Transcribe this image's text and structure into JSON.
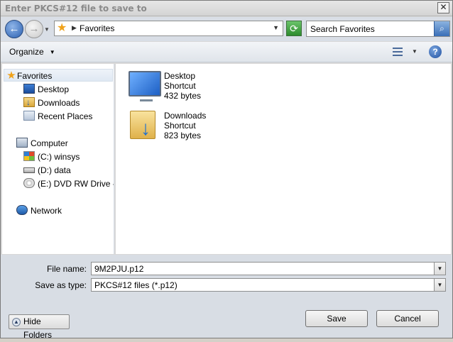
{
  "window": {
    "title": "Enter PKCS#12 file to save to",
    "close_glyph": "✕"
  },
  "nav": {
    "back_glyph": "←",
    "forward_glyph": "→",
    "address_location": "Favorites",
    "search_placeholder": "Search Favorites"
  },
  "toolbar": {
    "organize_label": "Organize",
    "help_glyph": "?"
  },
  "sidebar": {
    "favorites_label": "Favorites",
    "favorites_items": [
      {
        "label": "Desktop",
        "icon": "desktop-icon"
      },
      {
        "label": "Downloads",
        "icon": "downloads-icon"
      },
      {
        "label": "Recent Places",
        "icon": "recent-places-icon"
      }
    ],
    "computer_label": "Computer",
    "computer_items": [
      {
        "label": "(C:) winsys",
        "icon": "windows-drive-icon"
      },
      {
        "label": "(D:) data",
        "icon": "drive-icon"
      },
      {
        "label": "(E:) DVD RW Drive - D",
        "icon": "dvd-drive-icon"
      }
    ],
    "network_label": "Network"
  },
  "files": [
    {
      "name": "Desktop",
      "type": "Shortcut",
      "size": "432 bytes",
      "icon": "desktop-shortcut-icon"
    },
    {
      "name": "Downloads",
      "type": "Shortcut",
      "size": "823 bytes",
      "icon": "downloads-shortcut-icon"
    }
  ],
  "form": {
    "file_name_label": "File name:",
    "file_name_value": "9M2PJU.p12",
    "save_type_label": "Save as type:",
    "save_type_value": "PKCS#12 files (*.p12)"
  },
  "buttons": {
    "hide_folders": "Hide Folders",
    "save": "Save",
    "cancel": "Cancel"
  }
}
